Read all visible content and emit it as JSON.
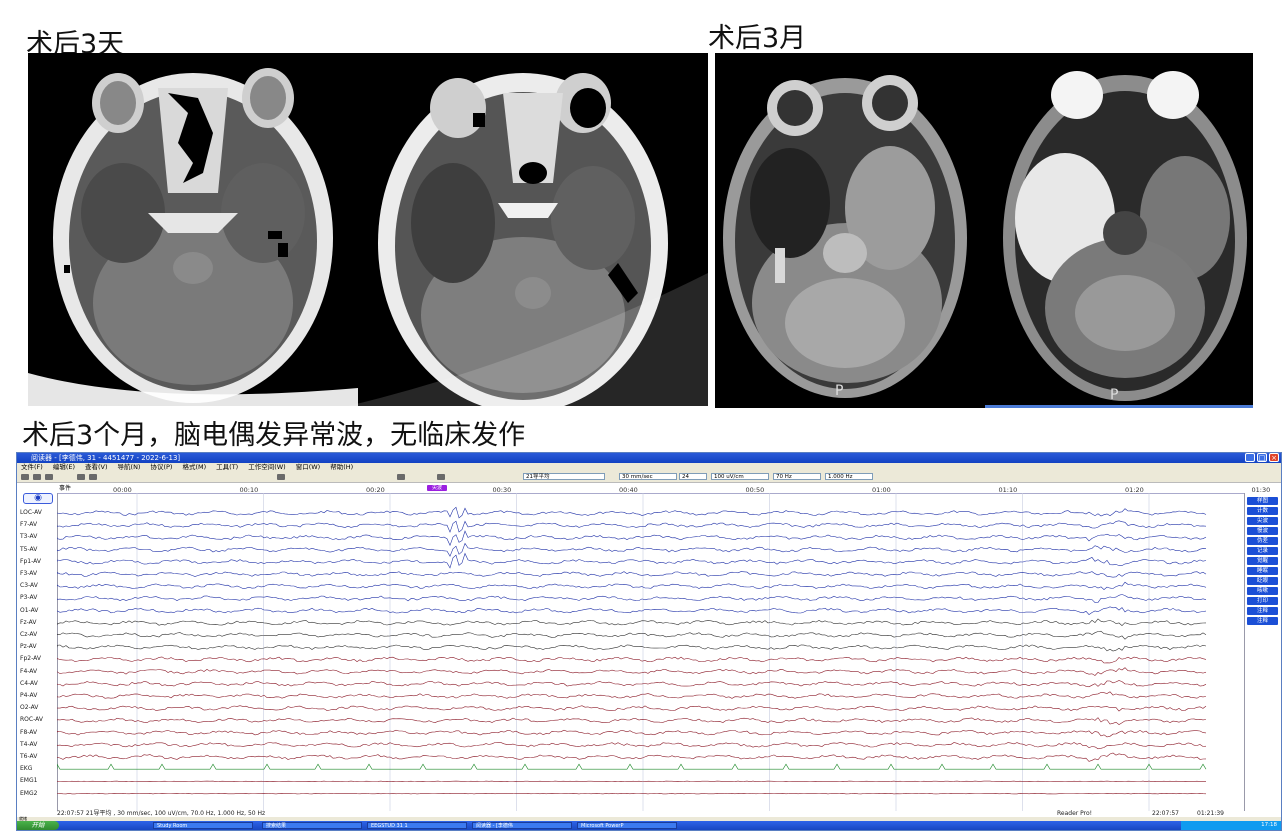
{
  "captions": {
    "post3days": "术后3天",
    "post3months": "术后3月",
    "eeg_caption": "术后3个月，脑电偶发异常波，无临床发作"
  },
  "mri_labels": {
    "left": "P",
    "right": "P"
  },
  "eeg_window": {
    "title": "阅读器 - [李德伟, 31 - 4451477 - 2022-6-13]",
    "menu": [
      "文件(F)",
      "编辑(E)",
      "查看(V)",
      "导航(N)",
      "协议(P)",
      "格式(M)",
      "工具(T)",
      "工作空间(W)",
      "窗口(W)",
      "帮助(H)"
    ],
    "toolbar": {
      "montage": "21导平均",
      "speed": "30 mm/sec",
      "channels": "24",
      "sensitivity": "100 uV/cm",
      "hf": "70 Hz",
      "lf": "1.000 Hz"
    },
    "event_label": "事件",
    "event_marker": "尖波",
    "time_ticks": [
      "00:00",
      "00:10",
      "00:20",
      "00:30",
      "00:40",
      "00:50",
      "01:00",
      "01:10",
      "01:20",
      "01:30"
    ],
    "channels": [
      {
        "name": "LOC-AV",
        "color": "#2233a8"
      },
      {
        "name": "F7-AV",
        "color": "#2233a8"
      },
      {
        "name": "T3-AV",
        "color": "#2233a8"
      },
      {
        "name": "T5-AV",
        "color": "#2233a8"
      },
      {
        "name": "Fp1-AV",
        "color": "#2233a8"
      },
      {
        "name": "F3-AV",
        "color": "#2233a8"
      },
      {
        "name": "C3-AV",
        "color": "#2233a8"
      },
      {
        "name": "P3-AV",
        "color": "#2233a8"
      },
      {
        "name": "O1-AV",
        "color": "#2233a8"
      },
      {
        "name": "Fz-AV",
        "color": "#333333"
      },
      {
        "name": "Cz-AV",
        "color": "#333333"
      },
      {
        "name": "Pz-AV",
        "color": "#333333"
      },
      {
        "name": "Fp2-AV",
        "color": "#8c1c2a"
      },
      {
        "name": "F4-AV",
        "color": "#8c1c2a"
      },
      {
        "name": "C4-AV",
        "color": "#8c1c2a"
      },
      {
        "name": "P4-AV",
        "color": "#8c1c2a"
      },
      {
        "name": "O2-AV",
        "color": "#8c1c2a"
      },
      {
        "name": "ROC-AV",
        "color": "#8c1c2a"
      },
      {
        "name": "F8-AV",
        "color": "#8c1c2a"
      },
      {
        "name": "T4-AV",
        "color": "#8c1c2a"
      },
      {
        "name": "T6-AV",
        "color": "#8c1c2a"
      },
      {
        "name": "EKG",
        "color": "#1e8a2a"
      },
      {
        "name": "EMG1",
        "color": "#8c1c2a"
      },
      {
        "name": "EMG2",
        "color": "#8c1c2a"
      }
    ],
    "right_buttons": [
      "样图",
      "计数",
      "尖波",
      "慢波",
      "伪差",
      "记录",
      "觉醒",
      "睡眠",
      "眨眼",
      "咳嗽",
      "打印",
      "注释",
      "注释"
    ],
    "status_text": "22:07:57 21导平均 , 30 mm/sec, 100 uV/cm, 70.0 Hz, 1.000 Hz, 50 Hz",
    "reader_text": "Reader Pro!",
    "time_start": "22:07:57",
    "time_elapsed": "01:21:39",
    "ready_text": "就绪",
    "start_label": "开始",
    "taskbar_items": [
      "Study Room",
      "搜索结果",
      "EEGSTUD 31 1",
      "阅读器 - [李德伟",
      "Microsoft PowerP"
    ],
    "clock": "17:18"
  }
}
